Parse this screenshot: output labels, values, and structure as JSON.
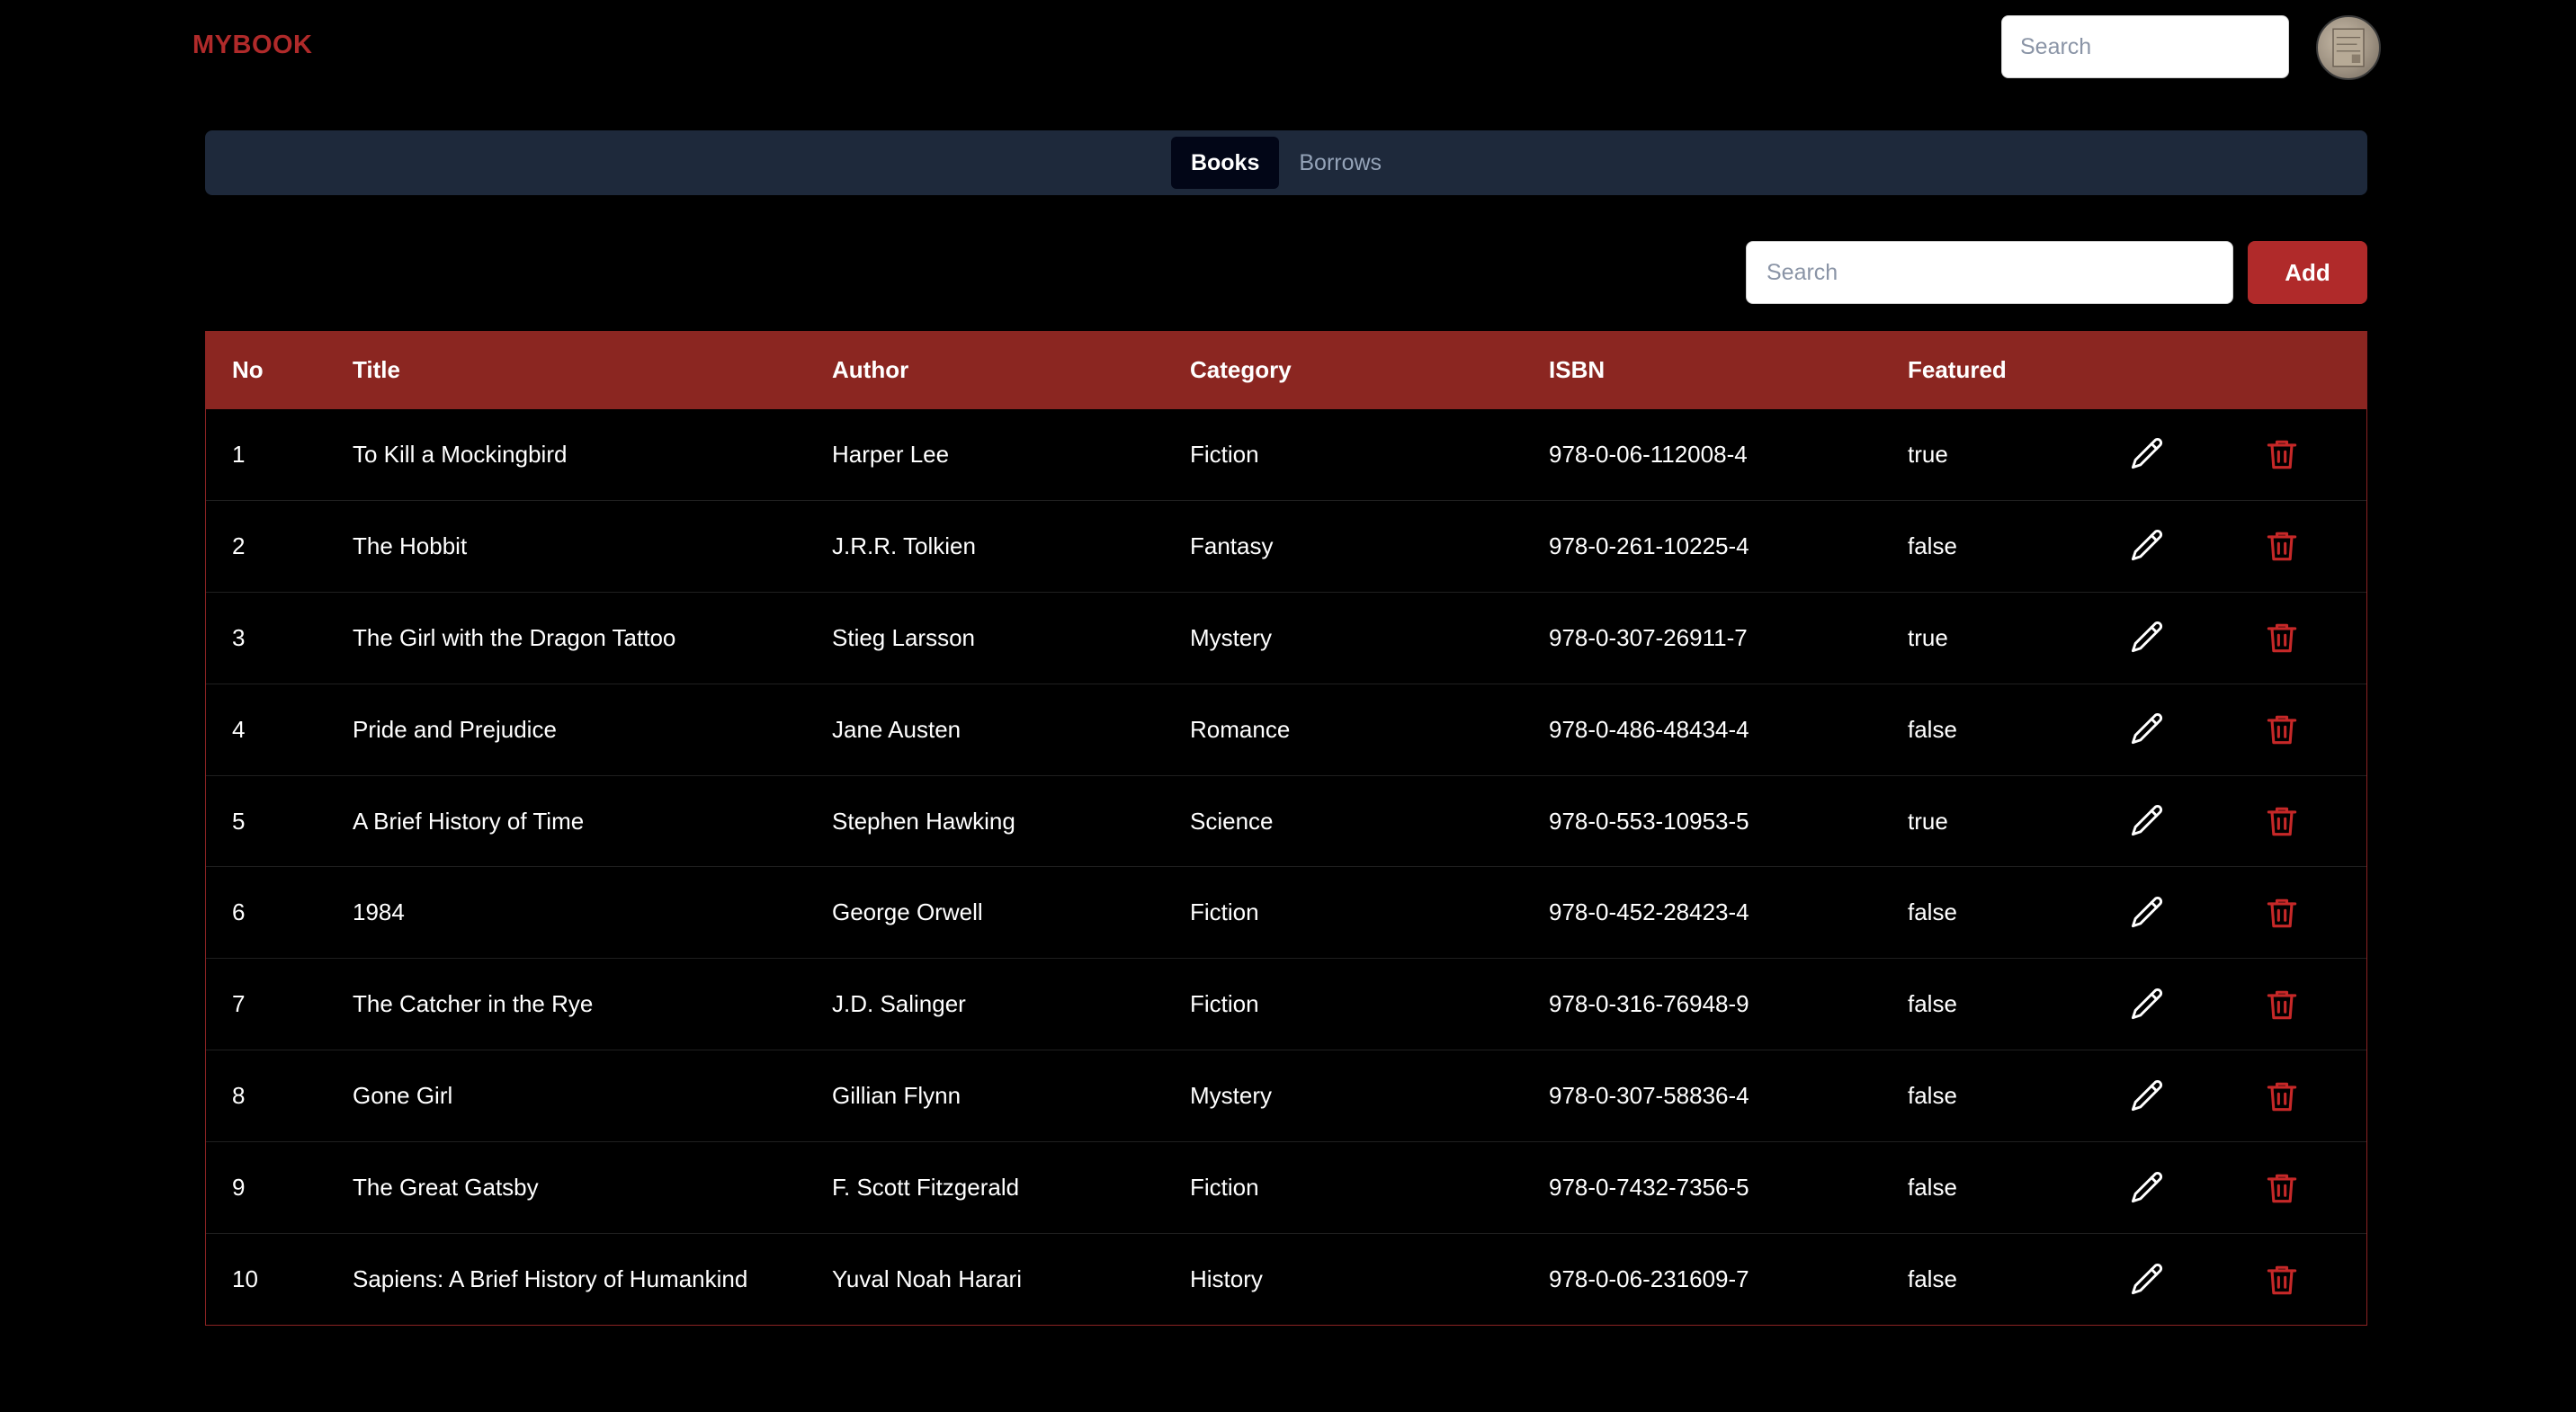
{
  "header": {
    "brand": "MYBOOK",
    "search_placeholder": "Search"
  },
  "tabs": [
    {
      "label": "Books",
      "active": true
    },
    {
      "label": "Borrows",
      "active": false
    }
  ],
  "toolbar": {
    "search_placeholder": "Search",
    "add_label": "Add"
  },
  "table": {
    "columns": [
      "No",
      "Title",
      "Author",
      "Category",
      "ISBN",
      "Featured"
    ],
    "rows": [
      {
        "no": "1",
        "title": "To Kill a Mockingbird",
        "author": "Harper Lee",
        "category": "Fiction",
        "isbn": "978-0-06-112008-4",
        "featured": "true"
      },
      {
        "no": "2",
        "title": "The Hobbit",
        "author": "J.R.R. Tolkien",
        "category": "Fantasy",
        "isbn": "978-0-261-10225-4",
        "featured": "false"
      },
      {
        "no": "3",
        "title": "The Girl with the Dragon Tattoo",
        "author": "Stieg Larsson",
        "category": "Mystery",
        "isbn": "978-0-307-26911-7",
        "featured": "true"
      },
      {
        "no": "4",
        "title": "Pride and Prejudice",
        "author": "Jane Austen",
        "category": "Romance",
        "isbn": "978-0-486-48434-4",
        "featured": "false"
      },
      {
        "no": "5",
        "title": "A Brief History of Time",
        "author": "Stephen Hawking",
        "category": "Science",
        "isbn": "978-0-553-10953-5",
        "featured": "true"
      },
      {
        "no": "6",
        "title": "1984",
        "author": "George Orwell",
        "category": "Fiction",
        "isbn": "978-0-452-28423-4",
        "featured": "false"
      },
      {
        "no": "7",
        "title": "The Catcher in the Rye",
        "author": "J.D. Salinger",
        "category": "Fiction",
        "isbn": "978-0-316-76948-9",
        "featured": "false"
      },
      {
        "no": "8",
        "title": "Gone Girl",
        "author": "Gillian Flynn",
        "category": "Mystery",
        "isbn": "978-0-307-58836-4",
        "featured": "false"
      },
      {
        "no": "9",
        "title": "The Great Gatsby",
        "author": "F. Scott Fitzgerald",
        "category": "Fiction",
        "isbn": "978-0-7432-7356-5",
        "featured": "false"
      },
      {
        "no": "10",
        "title": "Sapiens: A Brief History of Humankind",
        "author": "Yuval Noah Harari",
        "category": "History",
        "isbn": "978-0-06-231609-7",
        "featured": "false"
      }
    ]
  },
  "icons": {
    "edit": "pencil-icon",
    "delete": "trash-icon"
  },
  "colors": {
    "brand": "#b02a2a",
    "header_row": "#8b2621",
    "delete_icon": "#c62828",
    "tabs_bg": "#1e293b"
  }
}
